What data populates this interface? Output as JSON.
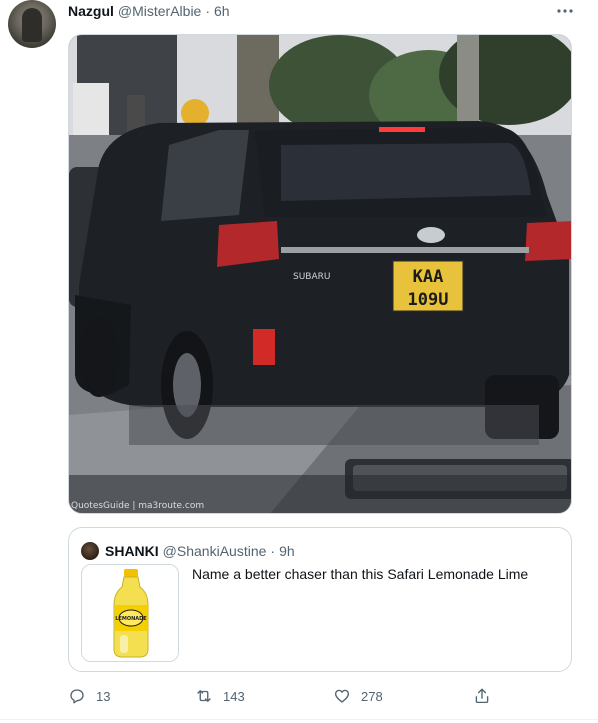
{
  "tweet": {
    "display_name": "Nazgul",
    "handle": "@MisterAlbie",
    "separator": "·",
    "time": "6h",
    "more_icon": "more-horizontal-icon",
    "media": {
      "plate_line1": "KAA",
      "plate_line2": "109U",
      "car_badge": "SUBARU",
      "watermark": "QuotesGuide | ma3route.com"
    }
  },
  "quote": {
    "display_name": "SHANKI",
    "handle": "@ShankiAustine",
    "separator": "·",
    "time": "9h",
    "text": "Name a better chaser than this Safari Lemonade Lime",
    "thumb_label": "LEMONADE"
  },
  "actions": {
    "reply": {
      "icon": "reply-icon",
      "count": "13"
    },
    "retweet": {
      "icon": "retweet-icon",
      "count": "143"
    },
    "like": {
      "icon": "heart-icon",
      "count": "278"
    },
    "share": {
      "icon": "share-icon"
    }
  },
  "colors": {
    "text_primary": "#0f1419",
    "text_secondary": "#536471",
    "border": "#cfd9de",
    "plate_yellow": "#e8c23a"
  }
}
